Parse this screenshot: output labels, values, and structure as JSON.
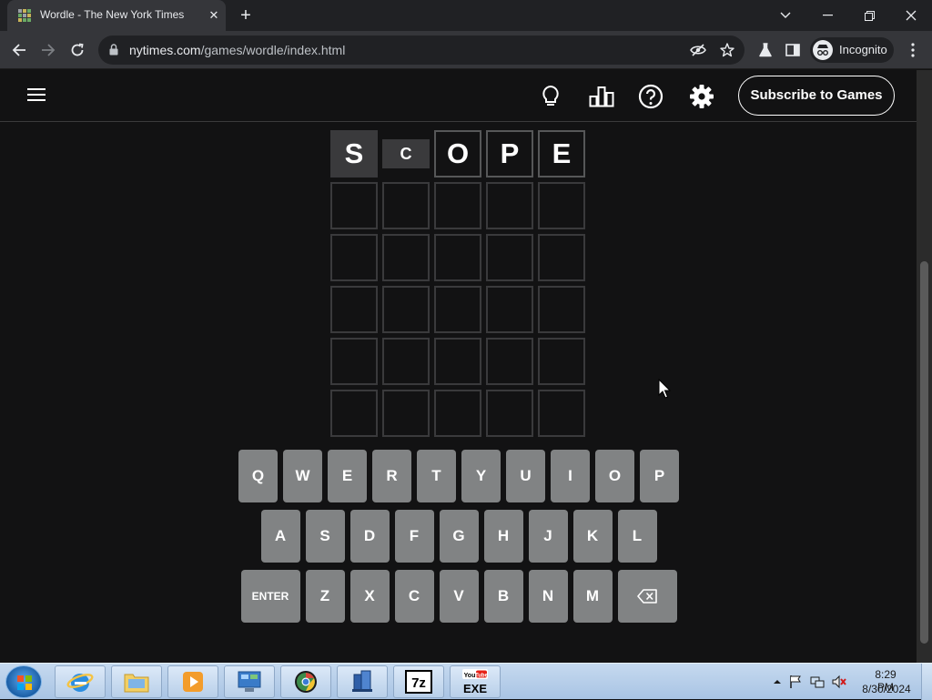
{
  "browser": {
    "tab_title": "Wordle - The New York Times",
    "url_domain": "nytimes.com",
    "url_path": "/games/wordle/index.html",
    "profile_label": "Incognito"
  },
  "header": {
    "subscribe_label": "Subscribe to Games"
  },
  "board": {
    "rows": [
      [
        "S",
        "C",
        "O",
        "P",
        "E"
      ],
      [
        "",
        "",
        "",
        "",
        ""
      ],
      [
        "",
        "",
        "",
        "",
        ""
      ],
      [
        "",
        "",
        "",
        "",
        ""
      ],
      [
        "",
        "",
        "",
        "",
        ""
      ],
      [
        "",
        "",
        "",
        "",
        ""
      ]
    ]
  },
  "keyboard": {
    "row1": [
      "Q",
      "W",
      "E",
      "R",
      "T",
      "Y",
      "U",
      "I",
      "O",
      "P"
    ],
    "row2": [
      "A",
      "S",
      "D",
      "F",
      "G",
      "H",
      "J",
      "K",
      "L"
    ],
    "row3_enter": "ENTER",
    "row3": [
      "Z",
      "X",
      "C",
      "V",
      "B",
      "N",
      "M"
    ]
  },
  "taskbar": {
    "clock_time": "8:29 PM",
    "clock_date": "8/30/2024"
  },
  "colors": {
    "page_bg": "#121213",
    "tile_border": "#3a3a3c",
    "key_bg": "#818384",
    "chrome_frame": "#202124",
    "chrome_toolbar": "#35363a"
  }
}
